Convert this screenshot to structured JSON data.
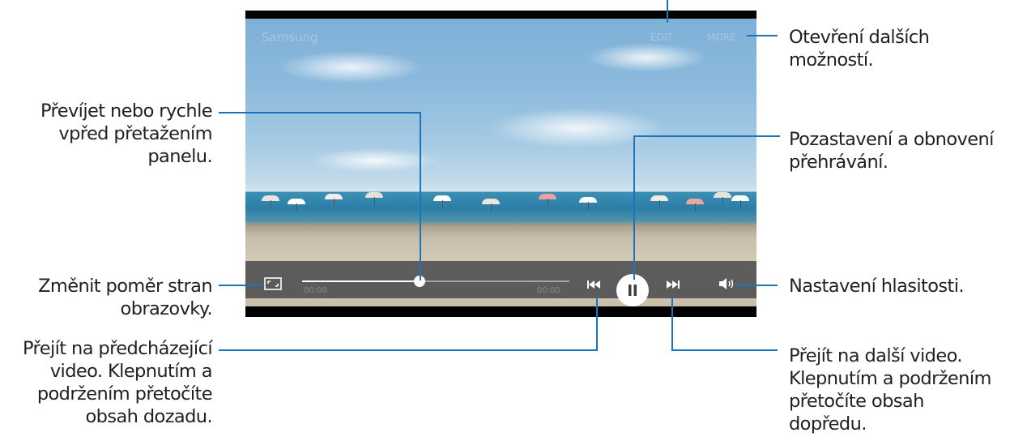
{
  "annotations": {
    "more_options": [
      "Otevření dalších",
      "možností."
    ],
    "seek": [
      "Převíjet nebo rychle",
      "vpřed přetažením",
      "panelu."
    ],
    "pause_resume": [
      "Pozastavení a obnovení",
      "přehrávání."
    ],
    "aspect_ratio": [
      "Změnit poměr stran",
      "obrazovky."
    ],
    "volume": [
      "Nastavení hlasitosti."
    ],
    "previous": [
      "Přejít na předcházející",
      "video. Klepnutím a",
      "podržením přetočíte",
      "obsah dozadu."
    ],
    "next": [
      "Přejít na další video.",
      "Klepnutím a podržením",
      "přetočíte obsah",
      "dopředu."
    ]
  },
  "player": {
    "title": "Samsung",
    "top_actions": [
      "EDIT",
      "MORE"
    ],
    "time_elapsed": "00:00",
    "time_total": "00:00",
    "progress": 0.44,
    "icons": [
      "aspect-ratio-icon",
      "previous-icon",
      "pause-icon",
      "next-icon",
      "volume-icon"
    ]
  },
  "colors": {
    "callout_line": "#1b75bb",
    "text": "#231f20",
    "control_bar": "#3c3e42"
  }
}
